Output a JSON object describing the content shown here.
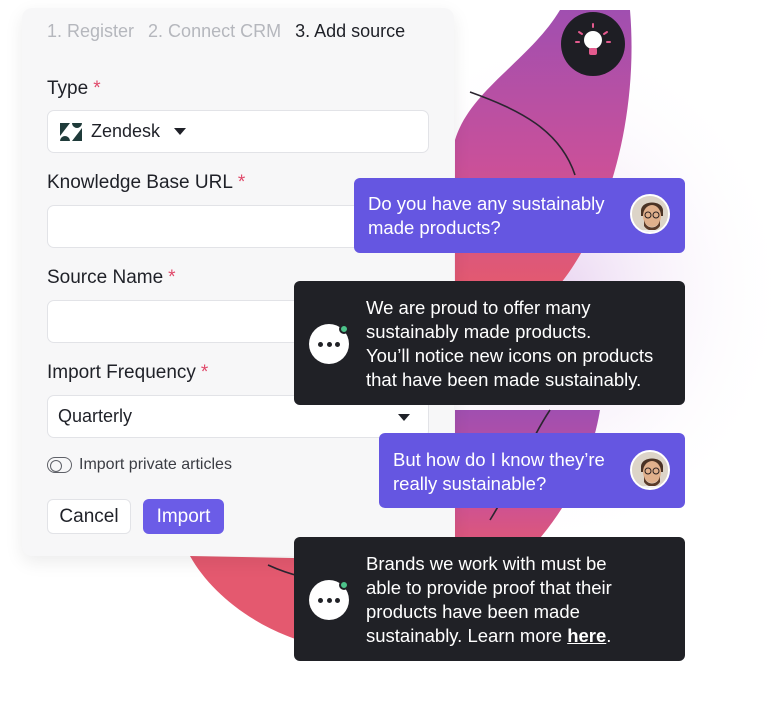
{
  "form": {
    "steps": [
      "1. Register",
      "2. Connect CRM",
      "3. Add source"
    ],
    "type_label": "Type",
    "type_value": "Zendesk",
    "kb_url_label": "Knowledge Base URL",
    "kb_url_value": "",
    "source_name_label": "Source Name",
    "source_name_value": "",
    "frequency_label": "Import Frequency",
    "frequency_value": "Quarterly",
    "private_label": "Import private articles",
    "private_enabled": false,
    "required_mark": "*",
    "cancel_label": "Cancel",
    "import_label": "Import"
  },
  "chat": {
    "messages": [
      {
        "from": "user",
        "lines": [
          "Do you have any sustainably",
          "made products?"
        ]
      },
      {
        "from": "bot",
        "lines": [
          "We are proud to offer many",
          "sustainably made products.",
          "You’ll notice new icons on products",
          "that have been made sustainably."
        ]
      },
      {
        "from": "user",
        "lines": [
          "But how do I know they’re",
          "really sustainable?"
        ]
      },
      {
        "from": "bot",
        "lines": [
          "Brands we work with must be",
          "able to provide proof that their",
          "products have been made"
        ],
        "last_line_prefix": "sustainably. Learn more ",
        "link_text": "here",
        "last_line_suffix": "."
      }
    ]
  },
  "colors": {
    "accent": "#6b5ce7",
    "user_bubble": "#6556e1",
    "bot_bubble": "#202126",
    "required": "#e0496a",
    "online": "#4cc38a"
  },
  "icons": [
    "zendesk-logo-icon",
    "chevron-down-icon",
    "toggle-icon",
    "user-avatar-icon",
    "chat-bot-icon",
    "lightbulb-icon"
  ]
}
